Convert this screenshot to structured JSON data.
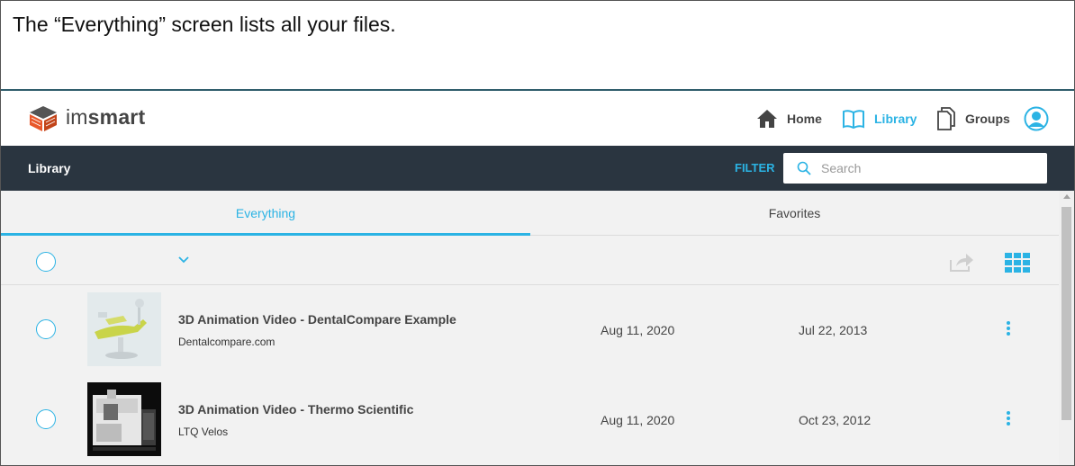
{
  "caption": "The “Everything” screen lists all your files.",
  "app": {
    "logo_text_light": "im",
    "logo_text_bold": "smart",
    "accent_color": "#2bb3e4",
    "header_dark_color": "#2a3540"
  },
  "nav": {
    "home": {
      "label": "Home",
      "icon": "home-icon"
    },
    "library": {
      "label": "Library",
      "icon": "book-icon"
    },
    "groups": {
      "label": "Groups",
      "icon": "documents-icon"
    },
    "profile_icon": "user-avatar-icon"
  },
  "subbar": {
    "title": "Library",
    "filter_label": "FILTER",
    "search_placeholder": "Search"
  },
  "tabs": {
    "everything": "Everything",
    "favorites": "Favorites",
    "active": "Everything"
  },
  "toolbar": {
    "icons": [
      "select-all-circle",
      "chevron-down-icon",
      "share-icon",
      "grid-view-icon"
    ]
  },
  "rows": [
    {
      "title": "3D Animation Video - DentalCompare Example",
      "subtitle": "Dentalcompare.com",
      "date1": "Aug 11, 2020",
      "date2": "Jul 22, 2013",
      "thumb": "dental-chair-thumbnail"
    },
    {
      "title": "3D Animation Video - Thermo Scientific",
      "subtitle": "LTQ Velos",
      "date1": "Aug 11, 2020",
      "date2": "Oct 23, 2012",
      "thumb": "lab-instrument-thumbnail"
    }
  ]
}
